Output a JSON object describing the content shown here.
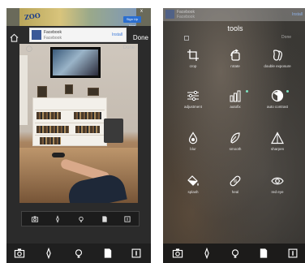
{
  "left_screen": {
    "ad_banner": {
      "logo": "ZOO",
      "cta_label": "Sign Up Now",
      "close_label": "x"
    },
    "facebook_ad": {
      "title": "Facebook",
      "subtitle": "Facebook",
      "install_label": "Install"
    },
    "done_label": "Done",
    "editor_done_label": "Done",
    "toolbar_icons": [
      "camera-icon",
      "brush-icon",
      "bulb-icon",
      "document-icon",
      "frame-icon"
    ]
  },
  "right_screen": {
    "facebook_ad": {
      "title": "Facebook",
      "subtitle": "Facebook",
      "install_label": "Install"
    },
    "title": "tools",
    "done_label": "Done",
    "tools": [
      {
        "label": "crop",
        "icon": "crop-icon"
      },
      {
        "label": "rotate",
        "icon": "rotate-icon"
      },
      {
        "label": "double exposure",
        "icon": "double-exposure-icon"
      },
      {
        "label": "adjustment",
        "icon": "sliders-icon"
      },
      {
        "label": "autofix",
        "icon": "autofix-icon"
      },
      {
        "label": "auto contrast",
        "icon": "auto-contrast-icon"
      },
      {
        "label": "blur",
        "icon": "drop-icon"
      },
      {
        "label": "smooth",
        "icon": "feather-icon"
      },
      {
        "label": "sharpen",
        "icon": "triangle-icon"
      },
      {
        "label": "splash",
        "icon": "paint-bucket-icon"
      },
      {
        "label": "heal",
        "icon": "bandage-icon"
      },
      {
        "label": "red eye",
        "icon": "eye-icon"
      }
    ],
    "toolbar_icons": [
      "camera-icon",
      "brush-icon",
      "bulb-icon",
      "document-icon",
      "frame-icon"
    ]
  },
  "colors": {
    "accent_dot": "#7fe0c0",
    "facebook_blue": "#3b5998",
    "install_blue": "#3b78d8"
  }
}
